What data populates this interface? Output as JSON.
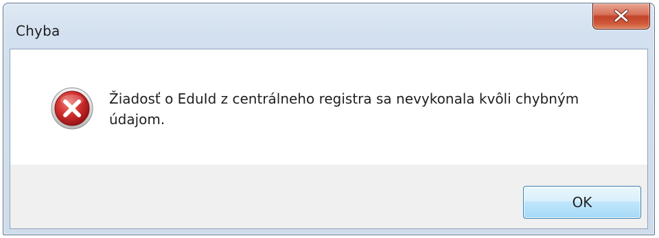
{
  "window": {
    "title": "Chyba"
  },
  "titlebar": {
    "close_icon": "close-x-icon"
  },
  "dialog": {
    "icon": "error-icon",
    "message": "Žiadosť o EduId z centrálneho registra sa nevykonala kvôli chybným údajom.",
    "ok_label": "OK"
  },
  "colors": {
    "close_button": "#c7452b",
    "error_icon": "#c8282a",
    "ok_button_border": "#3c7fb1",
    "footer_background": "#f0f0f0"
  }
}
